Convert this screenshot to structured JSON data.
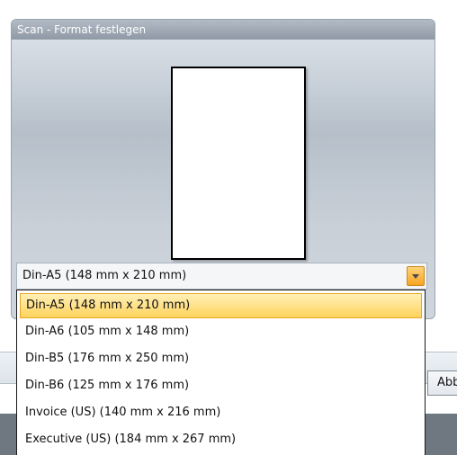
{
  "panel": {
    "title": "Scan - Format festlegen"
  },
  "combo": {
    "selected_value": "Din-A5 (148 mm x 210 mm)"
  },
  "dropdown": {
    "items": [
      {
        "label": "Din-A5 (148 mm x 210 mm)",
        "selected": true
      },
      {
        "label": "Din-A6 (105 mm x 148 mm)",
        "selected": false
      },
      {
        "label": "Din-B5 (176 mm x 250 mm)",
        "selected": false
      },
      {
        "label": "Din-B6 (125 mm x 176 mm)",
        "selected": false
      },
      {
        "label": "Invoice (US) (140 mm x 216 mm)",
        "selected": false
      },
      {
        "label": "Executive (US) (184 mm x 267 mm)",
        "selected": false
      }
    ]
  },
  "background": {
    "partial_button_label": "Abb"
  },
  "colors": {
    "highlight": "#ffd35c",
    "dropdown_arrow": "#f7a521",
    "panel_header": "#8f99a5"
  }
}
